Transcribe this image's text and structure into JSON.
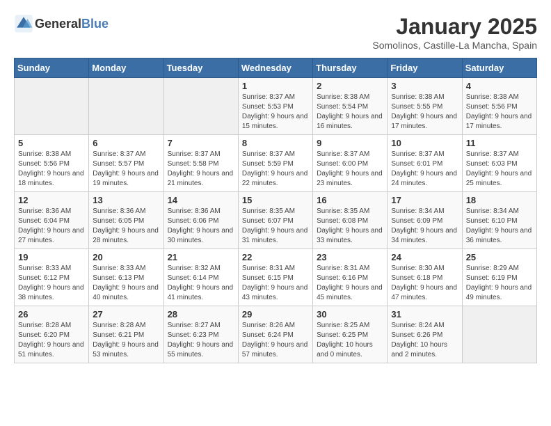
{
  "header": {
    "logo_general": "General",
    "logo_blue": "Blue",
    "title": "January 2025",
    "subtitle": "Somolinos, Castille-La Mancha, Spain"
  },
  "weekdays": [
    "Sunday",
    "Monday",
    "Tuesday",
    "Wednesday",
    "Thursday",
    "Friday",
    "Saturday"
  ],
  "weeks": [
    [
      {
        "day": "",
        "info": ""
      },
      {
        "day": "",
        "info": ""
      },
      {
        "day": "",
        "info": ""
      },
      {
        "day": "1",
        "info": "Sunrise: 8:37 AM\nSunset: 5:53 PM\nDaylight: 9 hours and 15 minutes."
      },
      {
        "day": "2",
        "info": "Sunrise: 8:38 AM\nSunset: 5:54 PM\nDaylight: 9 hours and 16 minutes."
      },
      {
        "day": "3",
        "info": "Sunrise: 8:38 AM\nSunset: 5:55 PM\nDaylight: 9 hours and 17 minutes."
      },
      {
        "day": "4",
        "info": "Sunrise: 8:38 AM\nSunset: 5:56 PM\nDaylight: 9 hours and 17 minutes."
      }
    ],
    [
      {
        "day": "5",
        "info": "Sunrise: 8:38 AM\nSunset: 5:56 PM\nDaylight: 9 hours and 18 minutes."
      },
      {
        "day": "6",
        "info": "Sunrise: 8:37 AM\nSunset: 5:57 PM\nDaylight: 9 hours and 19 minutes."
      },
      {
        "day": "7",
        "info": "Sunrise: 8:37 AM\nSunset: 5:58 PM\nDaylight: 9 hours and 21 minutes."
      },
      {
        "day": "8",
        "info": "Sunrise: 8:37 AM\nSunset: 5:59 PM\nDaylight: 9 hours and 22 minutes."
      },
      {
        "day": "9",
        "info": "Sunrise: 8:37 AM\nSunset: 6:00 PM\nDaylight: 9 hours and 23 minutes."
      },
      {
        "day": "10",
        "info": "Sunrise: 8:37 AM\nSunset: 6:01 PM\nDaylight: 9 hours and 24 minutes."
      },
      {
        "day": "11",
        "info": "Sunrise: 8:37 AM\nSunset: 6:03 PM\nDaylight: 9 hours and 25 minutes."
      }
    ],
    [
      {
        "day": "12",
        "info": "Sunrise: 8:36 AM\nSunset: 6:04 PM\nDaylight: 9 hours and 27 minutes."
      },
      {
        "day": "13",
        "info": "Sunrise: 8:36 AM\nSunset: 6:05 PM\nDaylight: 9 hours and 28 minutes."
      },
      {
        "day": "14",
        "info": "Sunrise: 8:36 AM\nSunset: 6:06 PM\nDaylight: 9 hours and 30 minutes."
      },
      {
        "day": "15",
        "info": "Sunrise: 8:35 AM\nSunset: 6:07 PM\nDaylight: 9 hours and 31 minutes."
      },
      {
        "day": "16",
        "info": "Sunrise: 8:35 AM\nSunset: 6:08 PM\nDaylight: 9 hours and 33 minutes."
      },
      {
        "day": "17",
        "info": "Sunrise: 8:34 AM\nSunset: 6:09 PM\nDaylight: 9 hours and 34 minutes."
      },
      {
        "day": "18",
        "info": "Sunrise: 8:34 AM\nSunset: 6:10 PM\nDaylight: 9 hours and 36 minutes."
      }
    ],
    [
      {
        "day": "19",
        "info": "Sunrise: 8:33 AM\nSunset: 6:12 PM\nDaylight: 9 hours and 38 minutes."
      },
      {
        "day": "20",
        "info": "Sunrise: 8:33 AM\nSunset: 6:13 PM\nDaylight: 9 hours and 40 minutes."
      },
      {
        "day": "21",
        "info": "Sunrise: 8:32 AM\nSunset: 6:14 PM\nDaylight: 9 hours and 41 minutes."
      },
      {
        "day": "22",
        "info": "Sunrise: 8:31 AM\nSunset: 6:15 PM\nDaylight: 9 hours and 43 minutes."
      },
      {
        "day": "23",
        "info": "Sunrise: 8:31 AM\nSunset: 6:16 PM\nDaylight: 9 hours and 45 minutes."
      },
      {
        "day": "24",
        "info": "Sunrise: 8:30 AM\nSunset: 6:18 PM\nDaylight: 9 hours and 47 minutes."
      },
      {
        "day": "25",
        "info": "Sunrise: 8:29 AM\nSunset: 6:19 PM\nDaylight: 9 hours and 49 minutes."
      }
    ],
    [
      {
        "day": "26",
        "info": "Sunrise: 8:28 AM\nSunset: 6:20 PM\nDaylight: 9 hours and 51 minutes."
      },
      {
        "day": "27",
        "info": "Sunrise: 8:28 AM\nSunset: 6:21 PM\nDaylight: 9 hours and 53 minutes."
      },
      {
        "day": "28",
        "info": "Sunrise: 8:27 AM\nSunset: 6:23 PM\nDaylight: 9 hours and 55 minutes."
      },
      {
        "day": "29",
        "info": "Sunrise: 8:26 AM\nSunset: 6:24 PM\nDaylight: 9 hours and 57 minutes."
      },
      {
        "day": "30",
        "info": "Sunrise: 8:25 AM\nSunset: 6:25 PM\nDaylight: 10 hours and 0 minutes."
      },
      {
        "day": "31",
        "info": "Sunrise: 8:24 AM\nSunset: 6:26 PM\nDaylight: 10 hours and 2 minutes."
      },
      {
        "day": "",
        "info": ""
      }
    ]
  ]
}
